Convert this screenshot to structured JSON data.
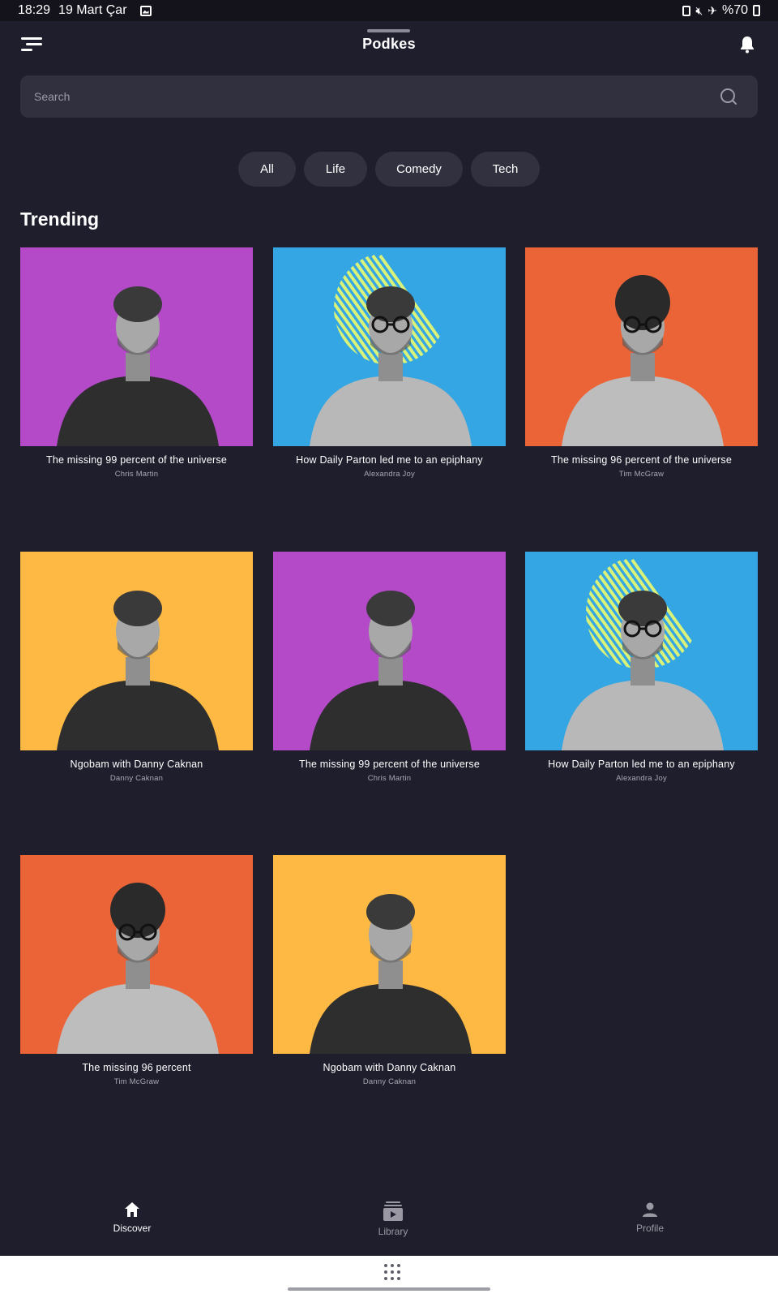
{
  "status_bar": {
    "time": "18:29",
    "date": "19 Mart Çar",
    "battery": "%70"
  },
  "header": {
    "title": "Podkes"
  },
  "search": {
    "placeholder": "Search"
  },
  "categories": [
    "All",
    "Life",
    "Comedy",
    "Tech"
  ],
  "section": {
    "title": "Trending"
  },
  "colors": {
    "background": "#1f1e2c",
    "purple": "#b44ac8",
    "blue": "#34a6e3",
    "orange": "#ea6438",
    "yellow": "#fdb944",
    "stripe": "#d9f27a"
  },
  "podcasts": [
    {
      "title": "The missing 99 percent of the universe",
      "author": "Chris Martin",
      "bg": "#b44ac8",
      "portrait": "side-profile-man"
    },
    {
      "title": "How Daily Parton led me to an epiphany",
      "author": "Alexandra Joy",
      "bg": "#34a6e3",
      "portrait": "man-glasses-crossed-arms"
    },
    {
      "title": "The missing 96 percent of the universe",
      "author": "Tim McGraw",
      "bg": "#ea6438",
      "portrait": "curly-hair-glasses-man"
    },
    {
      "title": "Ngobam with Danny Caknan",
      "author": "Danny Caknan",
      "bg": "#fdb944",
      "portrait": "young-man-tousled-hair"
    },
    {
      "title": "The missing 99 percent of the universe",
      "author": "Chris Martin",
      "bg": "#b44ac8",
      "portrait": "side-profile-man"
    },
    {
      "title": "How Daily Parton led me to an epiphany",
      "author": "Alexandra Joy",
      "bg": "#34a6e3",
      "portrait": "man-glasses-crossed-arms"
    },
    {
      "title": "The missing 96 percent",
      "author": "Tim McGraw",
      "bg": "#ea6438",
      "portrait": "curly-hair-glasses-man"
    },
    {
      "title": "Ngobam with Danny Caknan",
      "author": "Danny Caknan",
      "bg": "#fdb944",
      "portrait": "young-man-tousled-hair"
    }
  ],
  "bottom_nav": [
    {
      "label": "Discover",
      "icon": "home-icon",
      "active": true
    },
    {
      "label": "Library",
      "icon": "library-icon",
      "active": false
    },
    {
      "label": "Profile",
      "icon": "person-icon",
      "active": false
    }
  ]
}
